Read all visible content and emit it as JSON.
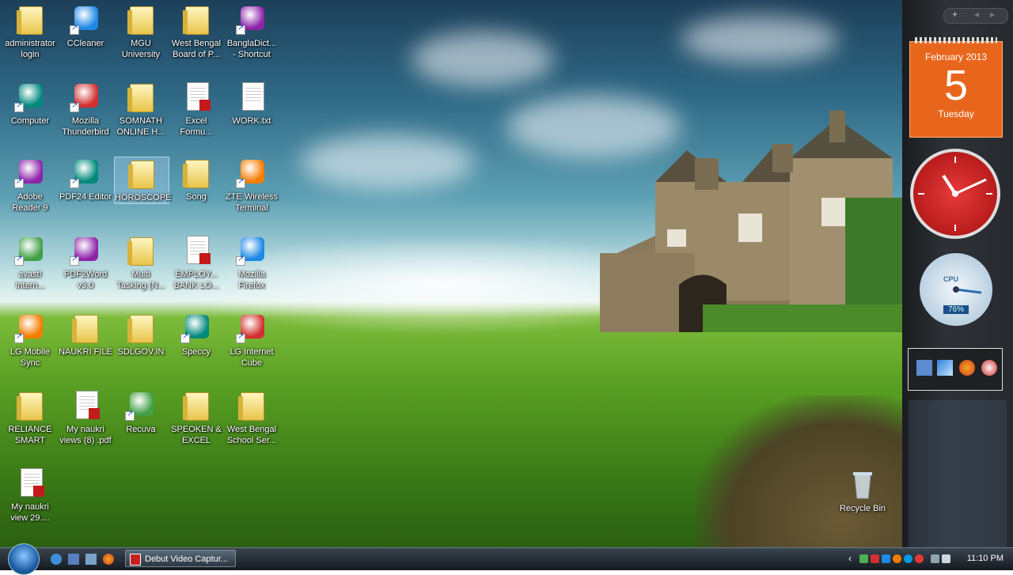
{
  "desktop": {
    "icons": [
      {
        "label": "administrator\nlogin",
        "kind": "folder"
      },
      {
        "label": "CCleaner",
        "kind": "app"
      },
      {
        "label": "MGU\nUniversity",
        "kind": "folder"
      },
      {
        "label": "West Bengal\nBoard of P...",
        "kind": "folder"
      },
      {
        "label": "BanglaDict...\n- Shortcut",
        "kind": "app"
      },
      {
        "label": "Computer",
        "kind": "app"
      },
      {
        "label": "Mozilla\nThunderbird",
        "kind": "app"
      },
      {
        "label": "SOMNATH\nONLINE H...",
        "kind": "folder"
      },
      {
        "label": "Excel\nFormu...",
        "kind": "pdf"
      },
      {
        "label": "WORK.txt",
        "kind": "doc"
      },
      {
        "label": "Adobe\nReader 9",
        "kind": "app"
      },
      {
        "label": "PDF24 Editor",
        "kind": "app"
      },
      {
        "label": "HOROSCOPE",
        "kind": "folder"
      },
      {
        "label": "Song",
        "kind": "folder"
      },
      {
        "label": "ZTE Wireless\nTerminal",
        "kind": "app"
      },
      {
        "label": "avast!\nIntern...",
        "kind": "app"
      },
      {
        "label": "PDF2Word\nv3.0",
        "kind": "app"
      },
      {
        "label": "Multi\nTasking (N...",
        "kind": "folder"
      },
      {
        "label": "EMPLOY...\nBANK LO...",
        "kind": "pdf"
      },
      {
        "label": "Mozilla\nFirefox",
        "kind": "app"
      },
      {
        "label": "LG Mobile\nSync",
        "kind": "app"
      },
      {
        "label": "NAUKRI FILE",
        "kind": "folder"
      },
      {
        "label": "SDLGOV.IN",
        "kind": "folder"
      },
      {
        "label": "Speccy",
        "kind": "app"
      },
      {
        "label": "LG Internet\nCube",
        "kind": "app"
      },
      {
        "label": "RELIANCE\nSMART",
        "kind": "folder"
      },
      {
        "label": "My naukri\nviews (8) .pdf",
        "kind": "pdf"
      },
      {
        "label": "Recuva",
        "kind": "app"
      },
      {
        "label": "SPEOKEN &\nEXCEL",
        "kind": "folder"
      },
      {
        "label": "West Bengal\nSchool Ser...",
        "kind": "folder"
      },
      {
        "label": "My naukri\nview 29....",
        "kind": "pdf"
      }
    ],
    "recycle_bin": "Recycle Bin"
  },
  "sidebar": {
    "add_label": "+",
    "calendar": {
      "month_year": "February 2013",
      "day": "5",
      "weekday": "Tuesday"
    },
    "cpu_gauge": {
      "label": "CPU",
      "value": "76%"
    }
  },
  "taskbar": {
    "task_button_label": "Debut Video Captur...",
    "clock": "11:10 PM"
  },
  "colors": {
    "accent_orange": "#e8661c",
    "clock_red": "#d22a2a"
  }
}
